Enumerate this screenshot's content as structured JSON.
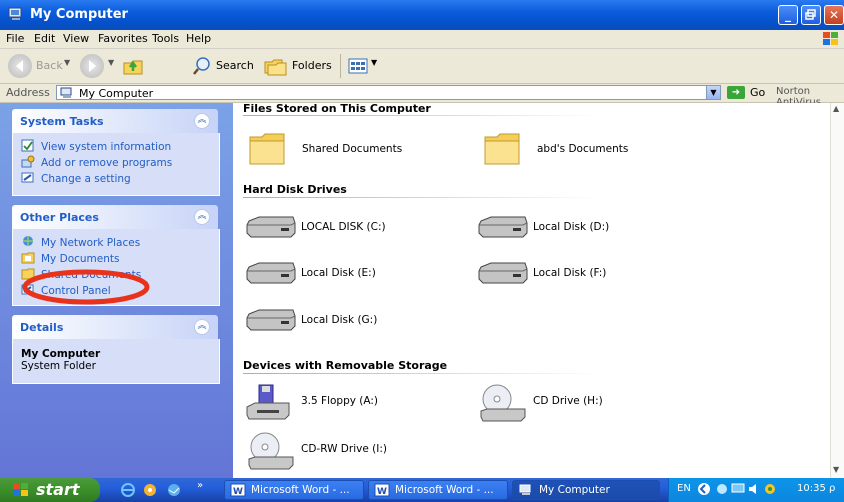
{
  "window": {
    "title": "My Computer"
  },
  "menu": [
    "File",
    "Edit",
    "View",
    "Favorites",
    "Tools",
    "Help"
  ],
  "toolbar": {
    "back": "Back",
    "search": "Search",
    "folders": "Folders"
  },
  "address": {
    "label": "Address",
    "value": "My Computer",
    "go": "Go",
    "norton": "Norton AntiVirus"
  },
  "left_panel": {
    "system_tasks": {
      "title": "System Tasks",
      "items": [
        "View system information",
        "Add or remove programs",
        "Change a setting"
      ]
    },
    "other_places": {
      "title": "Other Places",
      "items": [
        "My Network Places",
        "My Documents",
        "Shared Documents",
        "Control Panel"
      ]
    },
    "details": {
      "title": "Details",
      "name": "My Computer",
      "type": "System Folder"
    }
  },
  "main": {
    "groups": [
      {
        "title": "Files Stored on This Computer",
        "items": [
          "Shared Documents",
          "abd's Documents"
        ]
      },
      {
        "title": "Hard Disk Drives",
        "items": [
          "LOCAL DISK (C:)",
          "Local Disk (D:)",
          "Local Disk (E:)",
          "Local Disk (F:)",
          "Local Disk (G:)"
        ]
      },
      {
        "title": "Devices with Removable Storage",
        "items": [
          "3.5 Floppy (A:)",
          "CD Drive (H:)",
          "CD-RW Drive (I:)"
        ]
      }
    ]
  },
  "taskbar": {
    "start": "start",
    "buttons": [
      "Microsoft Word - ...",
      "Microsoft Word - ...",
      "My Computer"
    ],
    "lang": "EN",
    "clock": "10:35 ρ"
  },
  "colors": {
    "annotation_circle": "#e8321c",
    "task_link": "#215dc6"
  }
}
